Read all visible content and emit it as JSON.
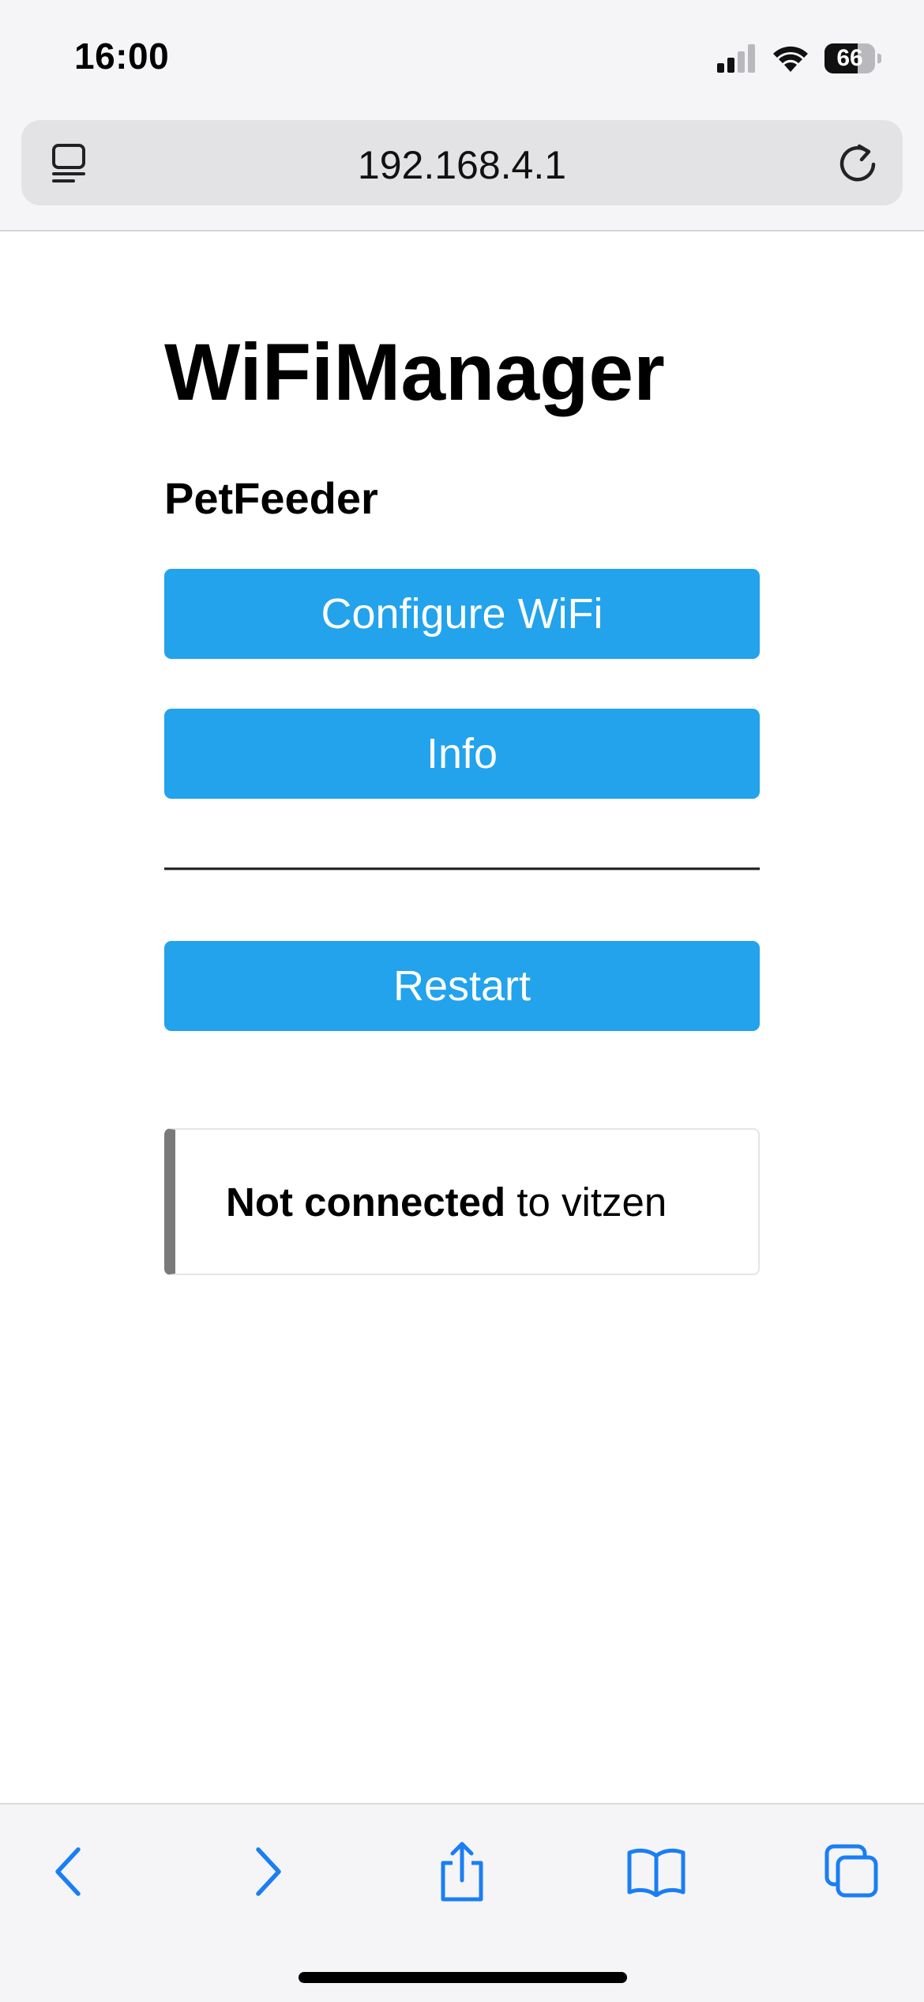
{
  "status_bar": {
    "time": "16:00",
    "battery_percent": 66,
    "battery_label": "66",
    "signal_bars_active": 2,
    "icons": [
      "cellular-signal-icon",
      "wifi-icon",
      "battery-icon"
    ]
  },
  "browser": {
    "url": "192.168.4.1",
    "icons": [
      "page-menu-icon",
      "reload-icon"
    ]
  },
  "page": {
    "title": "WiFiManager",
    "device_name": "PetFeeder",
    "buttons": {
      "configure_wifi": "Configure WiFi",
      "info": "Info",
      "restart": "Restart"
    },
    "status": {
      "state": "Not connected",
      "suffix": " to vitzen"
    },
    "colors": {
      "button": "#22a3ec",
      "status_border": "#7a7a7a"
    }
  },
  "toolbar": {
    "icons": [
      "back-icon",
      "forward-icon",
      "share-icon",
      "bookmarks-icon",
      "tabs-icon"
    ],
    "accent": "#1a7ef5"
  }
}
